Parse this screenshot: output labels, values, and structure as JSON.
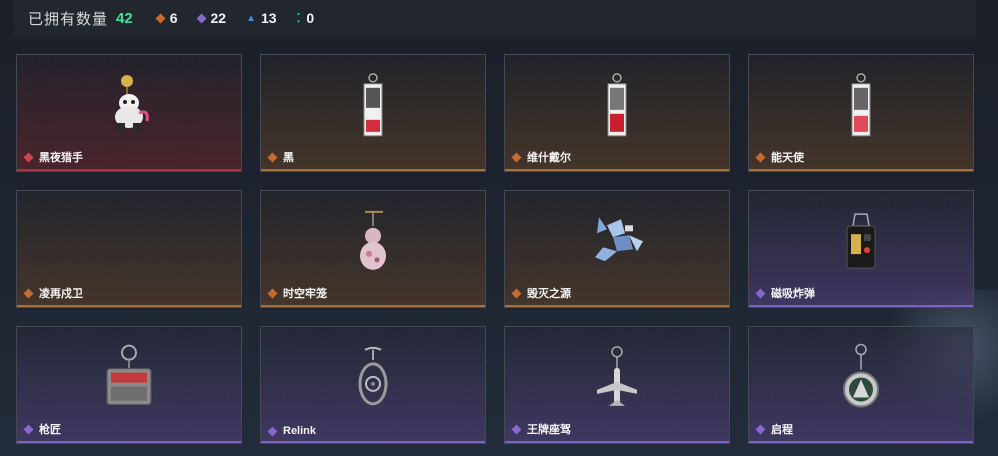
{
  "header": {
    "owned_label": "已拥有数量",
    "owned_count": "42",
    "stats": [
      {
        "icon": "orange-diamond-icon",
        "value": "6",
        "color": "#c56b2f"
      },
      {
        "icon": "purple-diamond-icon",
        "value": "22",
        "color": "#8a66cf"
      },
      {
        "icon": "blue-triangle-icon",
        "value": "13",
        "color": "#4c8ad6"
      },
      {
        "icon": "teal-dots-icon",
        "value": "0",
        "color": "#2ec6a6"
      }
    ]
  },
  "cards": [
    {
      "name": "黑夜猎手",
      "rarity": "red",
      "icon": "white-cat-figure-charm"
    },
    {
      "name": "黑",
      "rarity": "orange",
      "icon": "card-tag-charm"
    },
    {
      "name": "维什戴尔",
      "rarity": "orange",
      "icon": "card-tag-charm"
    },
    {
      "name": "能天使",
      "rarity": "orange",
      "icon": "card-tag-charm"
    },
    {
      "name": "凌再戍卫",
      "rarity": "orange",
      "icon": "none"
    },
    {
      "name": "时空牢笼",
      "rarity": "orange",
      "icon": "gourd-charm"
    },
    {
      "name": "毁灭之源",
      "rarity": "orange",
      "icon": "crystal-dragon-charm"
    },
    {
      "name": "磁吸炸弹",
      "rarity": "purple",
      "icon": "bomb-device-charm"
    },
    {
      "name": "枪匠",
      "rarity": "purple",
      "icon": "gun-case-charm"
    },
    {
      "name": "Relink",
      "rarity": "purple",
      "icon": "ornate-shield-charm"
    },
    {
      "name": "王牌座驾",
      "rarity": "purple",
      "icon": "jet-plane-charm"
    },
    {
      "name": "启程",
      "rarity": "purple",
      "icon": "round-medallion-charm"
    }
  ]
}
